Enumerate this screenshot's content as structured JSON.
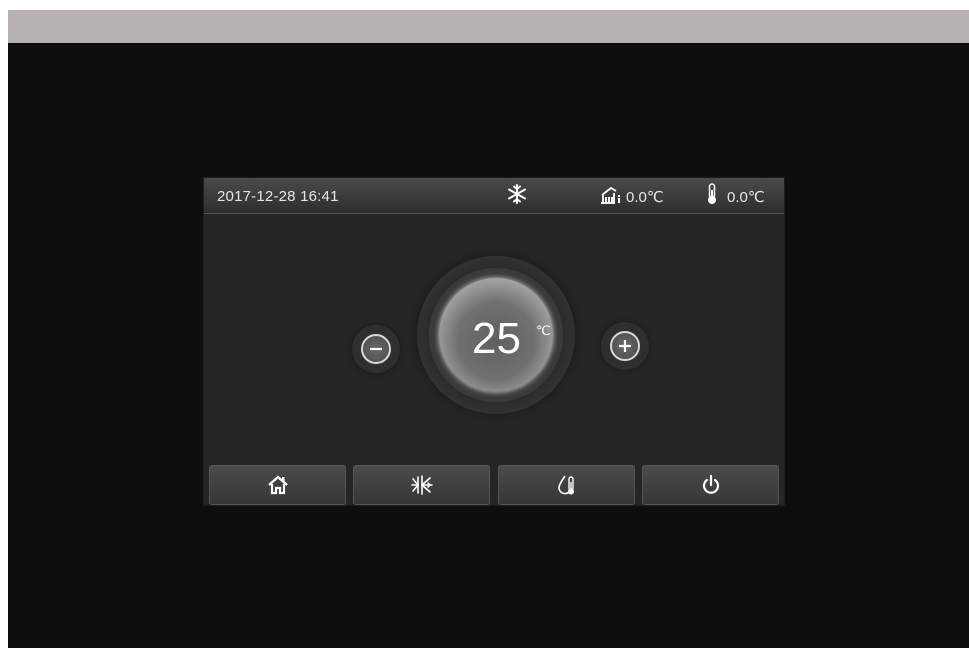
{
  "status_bar": {
    "datetime": "2017-12-28  16:41",
    "mode_icon": "snowflake-icon",
    "outdoor_temp": "0.0℃",
    "water_temp": "0.0℃"
  },
  "dial": {
    "set_temperature": "25",
    "unit": "℃"
  },
  "controls": {
    "decrease_icon": "minus-icon",
    "increase_icon": "plus-icon"
  },
  "nav": [
    {
      "icon": "home-icon"
    },
    {
      "icon": "mode-icon"
    },
    {
      "icon": "water-temp-icon"
    },
    {
      "icon": "power-icon"
    }
  ],
  "colors": {
    "background": "#0e0e0e",
    "panel": "#252525",
    "text": "#e6e6e6",
    "top_strip": "#b7b3b4"
  }
}
